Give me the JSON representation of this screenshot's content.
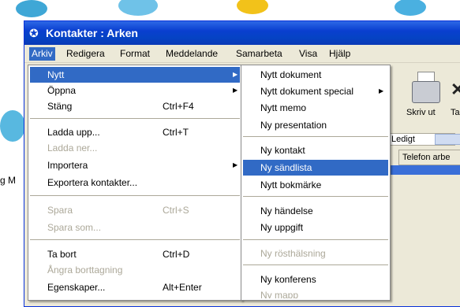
{
  "window": {
    "title": "Kontakter : Arken"
  },
  "menubar": [
    "Arkiv",
    "Redigera",
    "Format",
    "Meddelande",
    "Samarbeta",
    "Visa",
    "Hjälp"
  ],
  "toolbar": {
    "print_label": "Skriv ut",
    "partial_label": "Ta"
  },
  "background": {
    "status_free": "Ledigt",
    "column_phone": "Telefon arbe",
    "left_fragment": "g M"
  },
  "arkiv_menu": {
    "items": [
      {
        "label": "Nytt",
        "shortcut": "",
        "submenu": true,
        "disabled": false,
        "selected": true
      },
      {
        "label": "Öppna",
        "shortcut": "",
        "submenu": true,
        "disabled": false,
        "selected": false
      },
      {
        "label": "Stäng",
        "shortcut": "Ctrl+F4",
        "submenu": false,
        "disabled": false,
        "selected": false
      },
      {
        "label": "Ladda upp...",
        "shortcut": "Ctrl+T",
        "submenu": false,
        "disabled": false,
        "selected": false
      },
      {
        "label": "Ladda ner...",
        "shortcut": "",
        "submenu": false,
        "disabled": true,
        "selected": false
      },
      {
        "label": "Importera",
        "shortcut": "",
        "submenu": true,
        "disabled": false,
        "selected": false
      },
      {
        "label": "Exportera kontakter...",
        "shortcut": "",
        "submenu": false,
        "disabled": false,
        "selected": false
      },
      {
        "label": "Spara",
        "shortcut": "Ctrl+S",
        "submenu": false,
        "disabled": true,
        "selected": false
      },
      {
        "label": "Spara som...",
        "shortcut": "",
        "submenu": false,
        "disabled": true,
        "selected": false
      },
      {
        "label": "Ta bort",
        "shortcut": "Ctrl+D",
        "submenu": false,
        "disabled": false,
        "selected": false
      },
      {
        "label": "Ångra borttagning",
        "shortcut": "",
        "submenu": false,
        "disabled": true,
        "selected": false
      },
      {
        "label": "Egenskaper...",
        "shortcut": "Alt+Enter",
        "submenu": false,
        "disabled": false,
        "selected": false
      }
    ]
  },
  "nytt_submenu": {
    "items": [
      {
        "label": "Nytt dokument",
        "submenu": false,
        "disabled": false,
        "selected": false
      },
      {
        "label": "Nytt dokument special",
        "submenu": true,
        "disabled": false,
        "selected": false
      },
      {
        "label": "Nytt memo",
        "submenu": false,
        "disabled": false,
        "selected": false
      },
      {
        "label": "Ny presentation",
        "submenu": false,
        "disabled": false,
        "selected": false
      },
      {
        "label": "Ny kontakt",
        "submenu": false,
        "disabled": false,
        "selected": false
      },
      {
        "label": "Ny sändlista",
        "submenu": false,
        "disabled": false,
        "selected": true
      },
      {
        "label": "Nytt bokmärke",
        "submenu": false,
        "disabled": false,
        "selected": false
      },
      {
        "label": "Ny händelse",
        "submenu": false,
        "disabled": false,
        "selected": false
      },
      {
        "label": "Ny uppgift",
        "submenu": false,
        "disabled": false,
        "selected": false
      },
      {
        "label": "Ny rösthälsning",
        "submenu": false,
        "disabled": true,
        "selected": false
      },
      {
        "label": "Ny konferens",
        "submenu": false,
        "disabled": false,
        "selected": false
      },
      {
        "label": "Ny mapp",
        "submenu": false,
        "disabled": true,
        "selected": false
      }
    ]
  },
  "colors": {
    "selection": "#316ac5",
    "titlebar": "#0a3fd0",
    "disabled_text": "#aca899"
  }
}
